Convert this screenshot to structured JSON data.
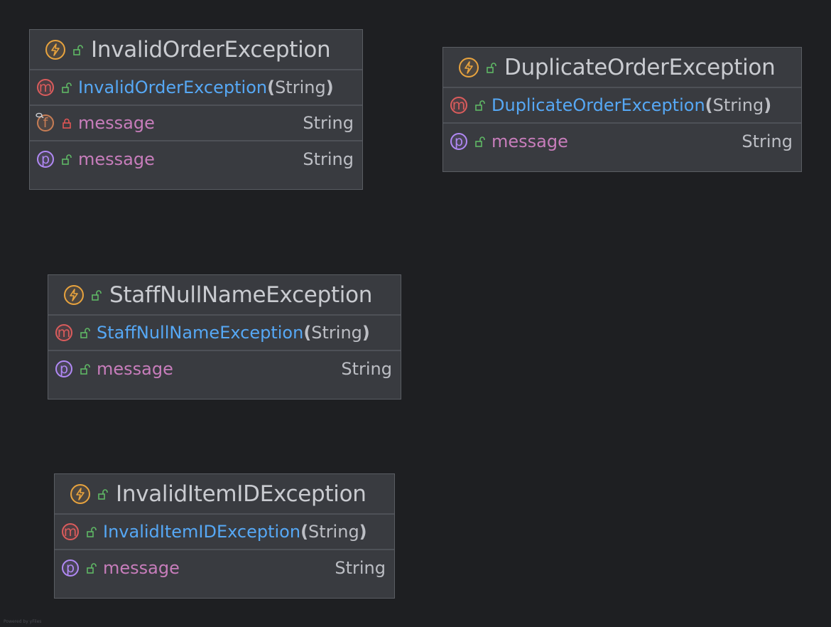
{
  "classes": [
    {
      "title": "InvalidOrderException",
      "constructor": {
        "name": "InvalidOrderException",
        "open": "(",
        "param": "String",
        "close": ")"
      },
      "field": {
        "name": "message",
        "type": "String"
      },
      "property": {
        "name": "message",
        "type": "String"
      }
    },
    {
      "title": "DuplicateOrderException",
      "constructor": {
        "name": "DuplicateOrderException",
        "open": "(",
        "param": "String",
        "close": ")"
      },
      "property": {
        "name": "message",
        "type": "String"
      }
    },
    {
      "title": "StaffNullNameException",
      "constructor": {
        "name": "StaffNullNameException",
        "open": "(",
        "param": "String",
        "close": ")"
      },
      "property": {
        "name": "message",
        "type": "String"
      }
    },
    {
      "title": "InvalidItemIDException",
      "constructor": {
        "name": "InvalidItemIDException",
        "open": "(",
        "param": "String",
        "close": ")"
      },
      "property": {
        "name": "message",
        "type": "String"
      }
    }
  ],
  "badges": {
    "method": "m",
    "field": "f",
    "property": "p"
  },
  "icons": {
    "class": "exception-class-icon",
    "public": "unlocked-icon",
    "private": "locked-icon",
    "final": "final-modifier-icon"
  },
  "colors": {
    "background": "#1e1f22",
    "box": "#393b40",
    "constructor": "#56a8f5",
    "field_name": "#c77dbb",
    "method_badge": "#db5c5c",
    "property_badge": "#b189f5",
    "field_badge": "#c77d55",
    "class_badge": "#e8a33e",
    "public": "#5fb865",
    "private": "#e05555"
  },
  "watermark": "Powered by yFiles"
}
